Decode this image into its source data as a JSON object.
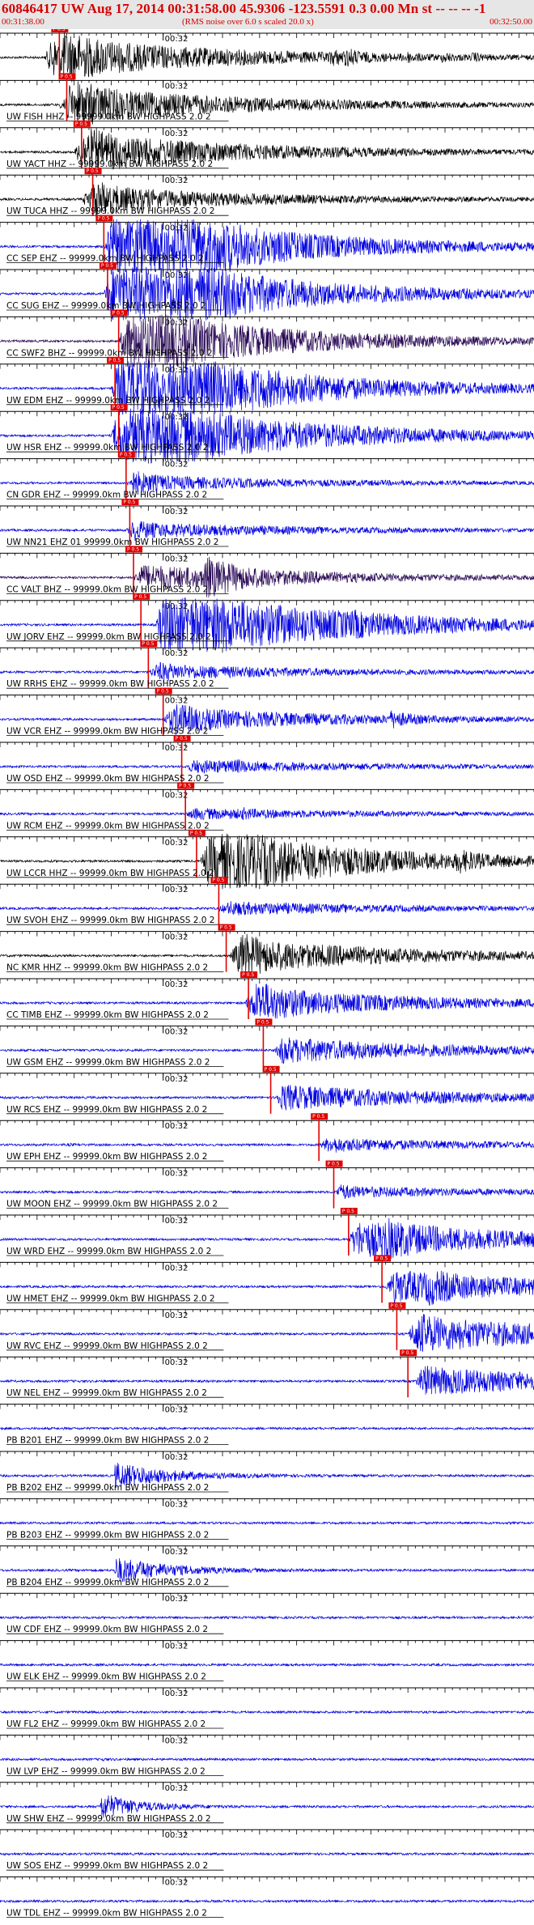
{
  "header": {
    "title": "60846417 UW Aug 17, 2014 00:31:58.00   45.9306 -123.5591  0.3 0.00 Mn st -- -- --  -1",
    "start_time": "00:31:38.00",
    "scale_note": "(RMS noise over 6.0 s scaled 20.0 x)",
    "end_time": "00:32:50.00"
  },
  "chart_data": {
    "type": "seismogram",
    "x_range_s": [
      0,
      72
    ],
    "minute_mark_label": "00:32",
    "minute_mark_s": 22,
    "colors": {
      "blue": "#0000e0",
      "black": "#000000",
      "purple": "#2a0a55",
      "pick": "#e00000"
    },
    "traces": [
      {
        "label": "",
        "color": "black",
        "pick_s": 8.0,
        "pick_label": "P 0.5",
        "onset_s": 6,
        "gain": 1.0,
        "events": [
          [
            9,
            12
          ],
          [
            45,
            6
          ],
          [
            47,
            6
          ],
          [
            55,
            4
          ],
          [
            60,
            4
          ],
          [
            64,
            4
          ]
        ]
      },
      {
        "label": "UW FISH HHZ -- 99999.0km BW  HIGHPASS  2.0  2",
        "color": "black",
        "pick_s": 9.0,
        "pick_label": "P 0.5",
        "onset_s": 8,
        "gain": 0.9,
        "events": [
          [
            11,
            10
          ]
        ]
      },
      {
        "label": "UW YACT HHZ -- 99999.0km BW  HIGHPASS  2.0  2",
        "color": "black",
        "pick_s": 11.0,
        "pick_label": "P 0.5",
        "onset_s": 10,
        "gain": 0.9,
        "events": [
          [
            12,
            10
          ]
        ]
      },
      {
        "label": "UW TUCA HHZ -- 99999.0km BW  HIGHPASS  2.0  2",
        "color": "black",
        "pick_s": 12.5,
        "pick_label": "P 0.5",
        "onset_s": 11,
        "gain": 0.6,
        "events": [
          [
            13,
            10
          ]
        ]
      },
      {
        "label": "CC SEP EHZ -- 99999.0km BW  HIGHPASS  2.0  2",
        "color": "blue",
        "pick_s": 14.0,
        "pick_label": "P 0.5",
        "onset_s": 14,
        "gain": 1.6,
        "events": [
          [
            16,
            30
          ],
          [
            24,
            30
          ]
        ]
      },
      {
        "label": "CC SUG EHZ -- 99999.0km BW  HIGHPASS  2.0  2",
        "color": "blue",
        "pick_s": 14.5,
        "pick_label": "P 0.5",
        "onset_s": 14,
        "gain": 1.6,
        "events": [
          [
            16,
            30
          ],
          [
            24,
            30
          ]
        ]
      },
      {
        "label": "CC SWF2 BHZ -- 99999.0km BW  HIGHPASS  2.0  2",
        "color": "purple",
        "pick_s": 16.0,
        "pick_label": "P 0.5",
        "onset_s": 16,
        "gain": 1.3,
        "events": [
          [
            18,
            30
          ]
        ]
      },
      {
        "label": "UW EDM EHZ -- 99999.0km BW  HIGHPASS  2.0  2",
        "color": "blue",
        "pick_s": 15.5,
        "pick_label": "P 0.5",
        "onset_s": 15,
        "gain": 1.7,
        "events": [
          [
            17,
            30
          ],
          [
            25,
            30
          ]
        ]
      },
      {
        "label": "UW HSR EHZ -- 99999.0km BW  HIGHPASS  2.0  2",
        "color": "blue",
        "pick_s": 16.0,
        "pick_label": "P 0.5",
        "onset_s": 15,
        "gain": 1.7,
        "events": [
          [
            17,
            30
          ]
        ]
      },
      {
        "label": "CN GDR EHZ -- 99999.0km BW  HIGHPASS  2.0  2",
        "color": "blue",
        "pick_s": 17.0,
        "pick_label": "P 0.5",
        "onset_s": 17,
        "gain": 0.35,
        "events": [
          [
            18,
            8
          ]
        ]
      },
      {
        "label": "UW NN21 EHZ 01 99999.0km BW  HIGHPASS  2.0  2",
        "color": "blue",
        "pick_s": 17.5,
        "pick_label": "P 0.5",
        "onset_s": 17,
        "gain": 0.35,
        "events": [
          [
            18,
            5
          ]
        ]
      },
      {
        "label": "CC VALT BHZ -- 99999.0km BW  HIGHPASS  2.0  2",
        "color": "purple",
        "pick_s": 18.0,
        "pick_label": "P 0.5",
        "onset_s": 18,
        "gain": 0.6,
        "events": [
          [
            28,
            18
          ]
        ]
      },
      {
        "label": "UW JORV EHZ -- 99999.0km BW  HIGHPASS  2.0  2",
        "color": "blue",
        "pick_s": 19.0,
        "pick_label": "P 0.5",
        "onset_s": 21,
        "gain": 1.8,
        "events": [
          [
            23,
            10
          ],
          [
            48,
            3
          ]
        ]
      },
      {
        "label": "UW RRHS EHZ -- 99999.0km BW  HIGHPASS  2.0  2",
        "color": "blue",
        "pick_s": 20.0,
        "pick_label": "P 0.5",
        "onset_s": 20,
        "gain": 0.35,
        "events": [
          [
            22,
            4
          ]
        ]
      },
      {
        "label": "UW VCR EHZ -- 99999.0km BW  HIGHPASS  2.0  2",
        "color": "blue",
        "pick_s": 22.0,
        "pick_label": "P 0.5",
        "onset_s": 22,
        "gain": 0.55,
        "events": [
          [
            24,
            8
          ],
          [
            53,
            8
          ]
        ]
      },
      {
        "label": "UW OSD EHZ -- 99999.0km BW  HIGHPASS  2.0  2",
        "color": "blue",
        "pick_s": 24.5,
        "pick_label": "P 0.5",
        "onset_s": 25,
        "gain": 0.3,
        "events": [
          [
            32,
            3
          ]
        ]
      },
      {
        "label": "UW RCM EHZ -- 99999.0km BW  HIGHPASS  2.0  2",
        "color": "blue",
        "pick_s": 25.0,
        "pick_label": "P 0.5",
        "onset_s": 25,
        "gain": 0.25,
        "events": [
          [
            33,
            3
          ]
        ]
      },
      {
        "label": "UW LCCR HHZ -- 99999.0km BW  HIGHPASS  2.0  2",
        "color": "black",
        "pick_s": 26.5,
        "pick_label": "P 0.5",
        "onset_s": 27,
        "gain": 1.2,
        "events": [
          [
            30,
            40
          ],
          [
            62,
            8
          ]
        ]
      },
      {
        "label": "UW SVOH EHZ -- 99999.0km BW  HIGHPASS  2.0  2",
        "color": "blue",
        "pick_s": 29.5,
        "pick_label": "P 0.5",
        "onset_s": 30,
        "gain": 0.3,
        "events": [
          [
            30,
            4
          ]
        ]
      },
      {
        "label": "NC KMR HHZ -- 99999.0km BW  HIGHPASS  2.0  2",
        "color": "black",
        "pick_s": 30.5,
        "pick_label": "P 0.5",
        "onset_s": 31,
        "gain": 0.8,
        "events": [
          [
            33,
            10
          ]
        ]
      },
      {
        "label": "CC TIMB EHZ -- 99999.0km BW  HIGHPASS  2.0  2",
        "color": "blue",
        "pick_s": 33.5,
        "pick_label": "P 0.5",
        "onset_s": 33,
        "gain": 0.7,
        "events": [
          [
            35,
            12
          ]
        ]
      },
      {
        "label": "UW GSM EHZ -- 99999.0km BW  HIGHPASS  2.0  2",
        "color": "blue",
        "pick_s": 35.5,
        "pick_label": "P 0.5",
        "onset_s": 37,
        "gain": 0.6,
        "events": [
          [
            38,
            3
          ]
        ]
      },
      {
        "label": "UW RCS EHZ -- 99999.0km BW  HIGHPASS  2.0  2",
        "color": "blue",
        "pick_s": 36.5,
        "pick_label": "P 0.5",
        "onset_s": 37,
        "gain": 0.6,
        "events": [
          [
            38,
            2
          ]
        ]
      },
      {
        "label": "UW EPH EHZ -- 99999.0km BW  HIGHPASS  2.0  2",
        "color": "blue",
        "pick_s": 43.0,
        "pick_label": "P 0.5",
        "onset_s": 43,
        "gain": 0.3,
        "events": [
          [
            9.5,
            1
          ],
          [
            45,
            3
          ]
        ]
      },
      {
        "label": "UW MOON EHZ -- 99999.0km BW  HIGHPASS  2.0  2",
        "color": "blue",
        "pick_s": 45.0,
        "pick_label": "P 0.5",
        "onset_s": 45,
        "gain": 0.25,
        "events": [
          [
            46,
            4
          ]
        ]
      },
      {
        "label": "UW WRD EHZ -- 99999.0km BW  HIGHPASS  2.0  2",
        "color": "blue",
        "pick_s": 47.0,
        "pick_label": "P 0.5",
        "onset_s": 47,
        "gain": 0.9,
        "events": [
          [
            52,
            10
          ]
        ]
      },
      {
        "label": "UW HMET EHZ -- 99999.0km BW  HIGHPASS  2.0  2",
        "color": "blue",
        "pick_s": 51.5,
        "pick_label": "P 0.5",
        "onset_s": 52,
        "gain": 0.8,
        "events": [
          [
            58,
            8
          ]
        ]
      },
      {
        "label": "UW RVC EHZ -- 99999.0km BW  HIGHPASS  2.0  2",
        "color": "blue",
        "pick_s": 53.5,
        "pick_label": "P 0.5",
        "onset_s": 55,
        "gain": 0.9,
        "events": [
          [
            57,
            4
          ]
        ]
      },
      {
        "label": "UW NEL EHZ -- 99999.0km BW  HIGHPASS  2.0  2",
        "color": "blue",
        "pick_s": 55.0,
        "pick_label": "P 0.5",
        "onset_s": 56,
        "gain": 0.7,
        "events": [
          [
            57,
            3
          ]
        ]
      },
      {
        "label": "PB B201 EHZ -- 99999.0km BW  HIGHPASS  2.0  2",
        "color": "blue",
        "pick_s": null,
        "pick_label": "",
        "onset_s": null,
        "gain": 0,
        "events": []
      },
      {
        "label": "PB B202 EHZ -- 99999.0km BW  HIGHPASS  2.0  2",
        "color": "blue",
        "pick_s": null,
        "pick_label": "",
        "onset_s": null,
        "gain": 0,
        "events": [
          [
            16,
            30
          ]
        ]
      },
      {
        "label": "PB B203 EHZ -- 99999.0km BW  HIGHPASS  2.0  2",
        "color": "blue",
        "pick_s": null,
        "pick_label": "",
        "onset_s": null,
        "gain": 0,
        "events": []
      },
      {
        "label": "PB B204 EHZ -- 99999.0km BW  HIGHPASS  2.0  2",
        "color": "blue",
        "pick_s": null,
        "pick_label": "",
        "onset_s": null,
        "gain": 0,
        "events": [
          [
            16,
            30
          ]
        ]
      },
      {
        "label": "UW CDF EHZ -- 99999.0km BW  HIGHPASS  2.0  2",
        "color": "blue",
        "pick_s": null,
        "pick_label": "",
        "onset_s": null,
        "gain": 0,
        "events": []
      },
      {
        "label": "UW ELK EHZ -- 99999.0km BW  HIGHPASS  2.0  2",
        "color": "blue",
        "pick_s": null,
        "pick_label": "",
        "onset_s": null,
        "gain": 0,
        "events": []
      },
      {
        "label": "UW FL2 EHZ -- 99999.0km BW  HIGHPASS  2.0  2",
        "color": "blue",
        "pick_s": null,
        "pick_label": "",
        "onset_s": null,
        "gain": 0,
        "events": []
      },
      {
        "label": "UW LVP EHZ -- 99999.0km BW  HIGHPASS  2.0  2",
        "color": "blue",
        "pick_s": null,
        "pick_label": "",
        "onset_s": null,
        "gain": 0,
        "events": [
          [
            14,
            1
          ]
        ]
      },
      {
        "label": "UW SHW EHZ -- 99999.0km BW  HIGHPASS  2.0  2",
        "color": "blue",
        "pick_s": null,
        "pick_label": "",
        "onset_s": null,
        "gain": 0,
        "events": [
          [
            14,
            20
          ]
        ]
      },
      {
        "label": "UW SOS EHZ -- 99999.0km BW  HIGHPASS  2.0  2",
        "color": "blue",
        "pick_s": null,
        "pick_label": "",
        "onset_s": null,
        "gain": 0,
        "events": []
      },
      {
        "label": "UW TDL EHZ -- 99999.0km BW  HIGHPASS  2.0  2",
        "color": "blue",
        "pick_s": null,
        "pick_label": "",
        "onset_s": null,
        "gain": 0,
        "events": []
      }
    ]
  }
}
